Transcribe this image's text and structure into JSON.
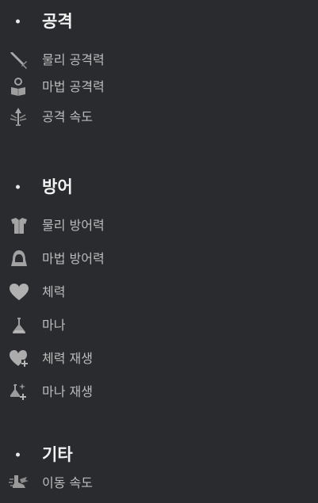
{
  "sections": [
    {
      "title": "공격",
      "items": [
        {
          "label": "물리 공격력",
          "icon": "sword-icon"
        },
        {
          "label": "마법 공격력",
          "icon": "magic-book-icon"
        },
        {
          "label": "공격 속도",
          "icon": "arrow-speed-icon"
        }
      ]
    },
    {
      "title": "방어",
      "items": [
        {
          "label": "물리 방어력",
          "icon": "armor-icon"
        },
        {
          "label": "마법 방어력",
          "icon": "hood-icon"
        },
        {
          "label": "체력",
          "icon": "heart-icon"
        },
        {
          "label": "마나",
          "icon": "flask-icon"
        },
        {
          "label": "체력 재생",
          "icon": "heart-regen-icon"
        },
        {
          "label": "마나 재생",
          "icon": "flask-regen-icon"
        }
      ]
    },
    {
      "title": "기타",
      "items": [
        {
          "label": "이동 속도",
          "icon": "running-boot-icon"
        }
      ]
    }
  ]
}
